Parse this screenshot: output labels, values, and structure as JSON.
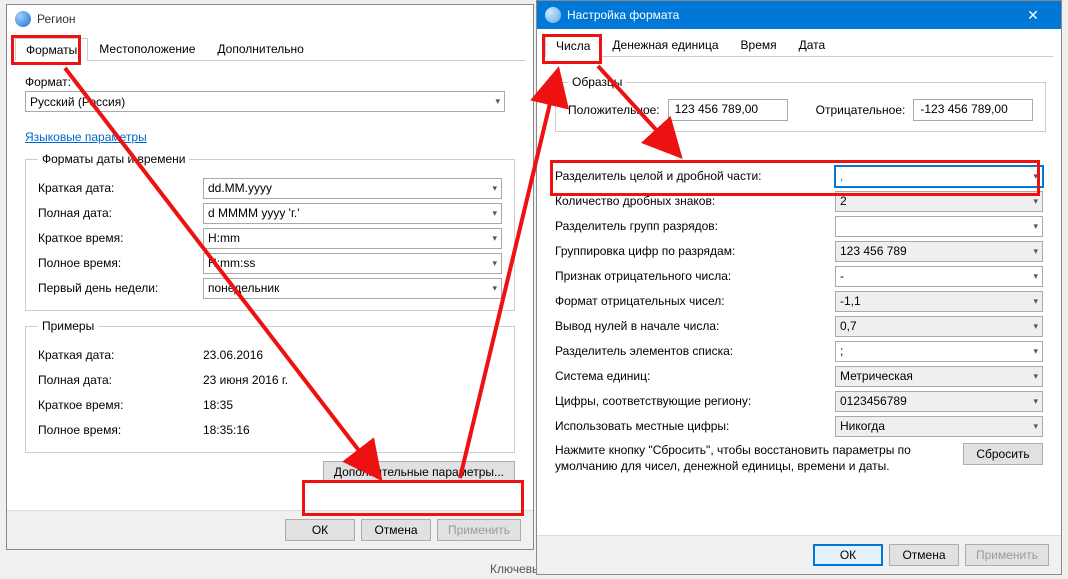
{
  "region_dialog": {
    "title": "Регион",
    "tabs": {
      "formats": "Форматы",
      "location": "Местоположение",
      "additional": "Дополнительно"
    },
    "format_label": "Формат:",
    "format_value": "Русский (Россия)",
    "lang_params_link": "Языковые параметры",
    "group_datetime": "Форматы даты и времени",
    "labels": {
      "short_date": "Краткая дата:",
      "long_date": "Полная дата:",
      "short_time": "Краткое время:",
      "long_time": "Полное время:",
      "first_day": "Первый день недели:"
    },
    "values": {
      "short_date": "dd.MM.yyyy",
      "long_date": "d MMMM yyyy 'г.'",
      "short_time": "H:mm",
      "long_time": "H:mm:ss",
      "first_day": "понедельник"
    },
    "examples_group": "Примеры",
    "examples": {
      "short_date_lbl": "Краткая дата:",
      "short_date_val": "23.06.2016",
      "long_date_lbl": "Полная дата:",
      "long_date_val": "23 июня 2016 г.",
      "short_time_lbl": "Краткое время:",
      "short_time_val": "18:35",
      "long_time_lbl": "Полное время:",
      "long_time_val": "18:35:16"
    },
    "additional_params_btn": "Дополнительные параметры...",
    "ok": "ОК",
    "cancel": "Отмена",
    "apply": "Применить"
  },
  "format_dialog": {
    "title": "Настройка формата",
    "tabs": {
      "numbers": "Числа",
      "currency": "Денежная единица",
      "time": "Время",
      "date": "Дата"
    },
    "samples_group": "Образцы",
    "positive_lbl": "Положительное:",
    "positive_val": "123 456 789,00",
    "negative_lbl": "Отрицательное:",
    "negative_val": "-123 456 789,00",
    "rows": {
      "decimal_sep": "Разделитель целой и дробной части:",
      "decimal_count": "Количество дробных знаков:",
      "group_sep": "Разделитель групп разрядов:",
      "grouping": "Группировка цифр по разрядам:",
      "neg_sign": "Признак отрицательного числа:",
      "neg_format": "Формат отрицательных чисел:",
      "leading_zero": "Вывод нулей в начале числа:",
      "list_sep": "Разделитель элементов списка:",
      "system": "Система единиц:",
      "native_digits": "Цифры, соответствующие региону:",
      "use_native": "Использовать местные цифры:"
    },
    "values": {
      "decimal_sep": ",",
      "decimal_count": "2",
      "group_sep": " ",
      "grouping": "123 456 789",
      "neg_sign": "-",
      "neg_format": "-1,1",
      "leading_zero": "0,7",
      "list_sep": ";",
      "system": "Метрическая",
      "native_digits": "0123456789",
      "use_native": "Никогда"
    },
    "reset_text": "Нажмите кнопку \"Сбросить\", чтобы восстановить параметры по умолчанию для чисел, денежной единицы, времени и даты.",
    "reset_btn": "Сбросить",
    "ok": "ОК",
    "cancel": "Отмена",
    "apply": "Применить"
  },
  "misc": {
    "keywords_label": "Ключевы"
  }
}
